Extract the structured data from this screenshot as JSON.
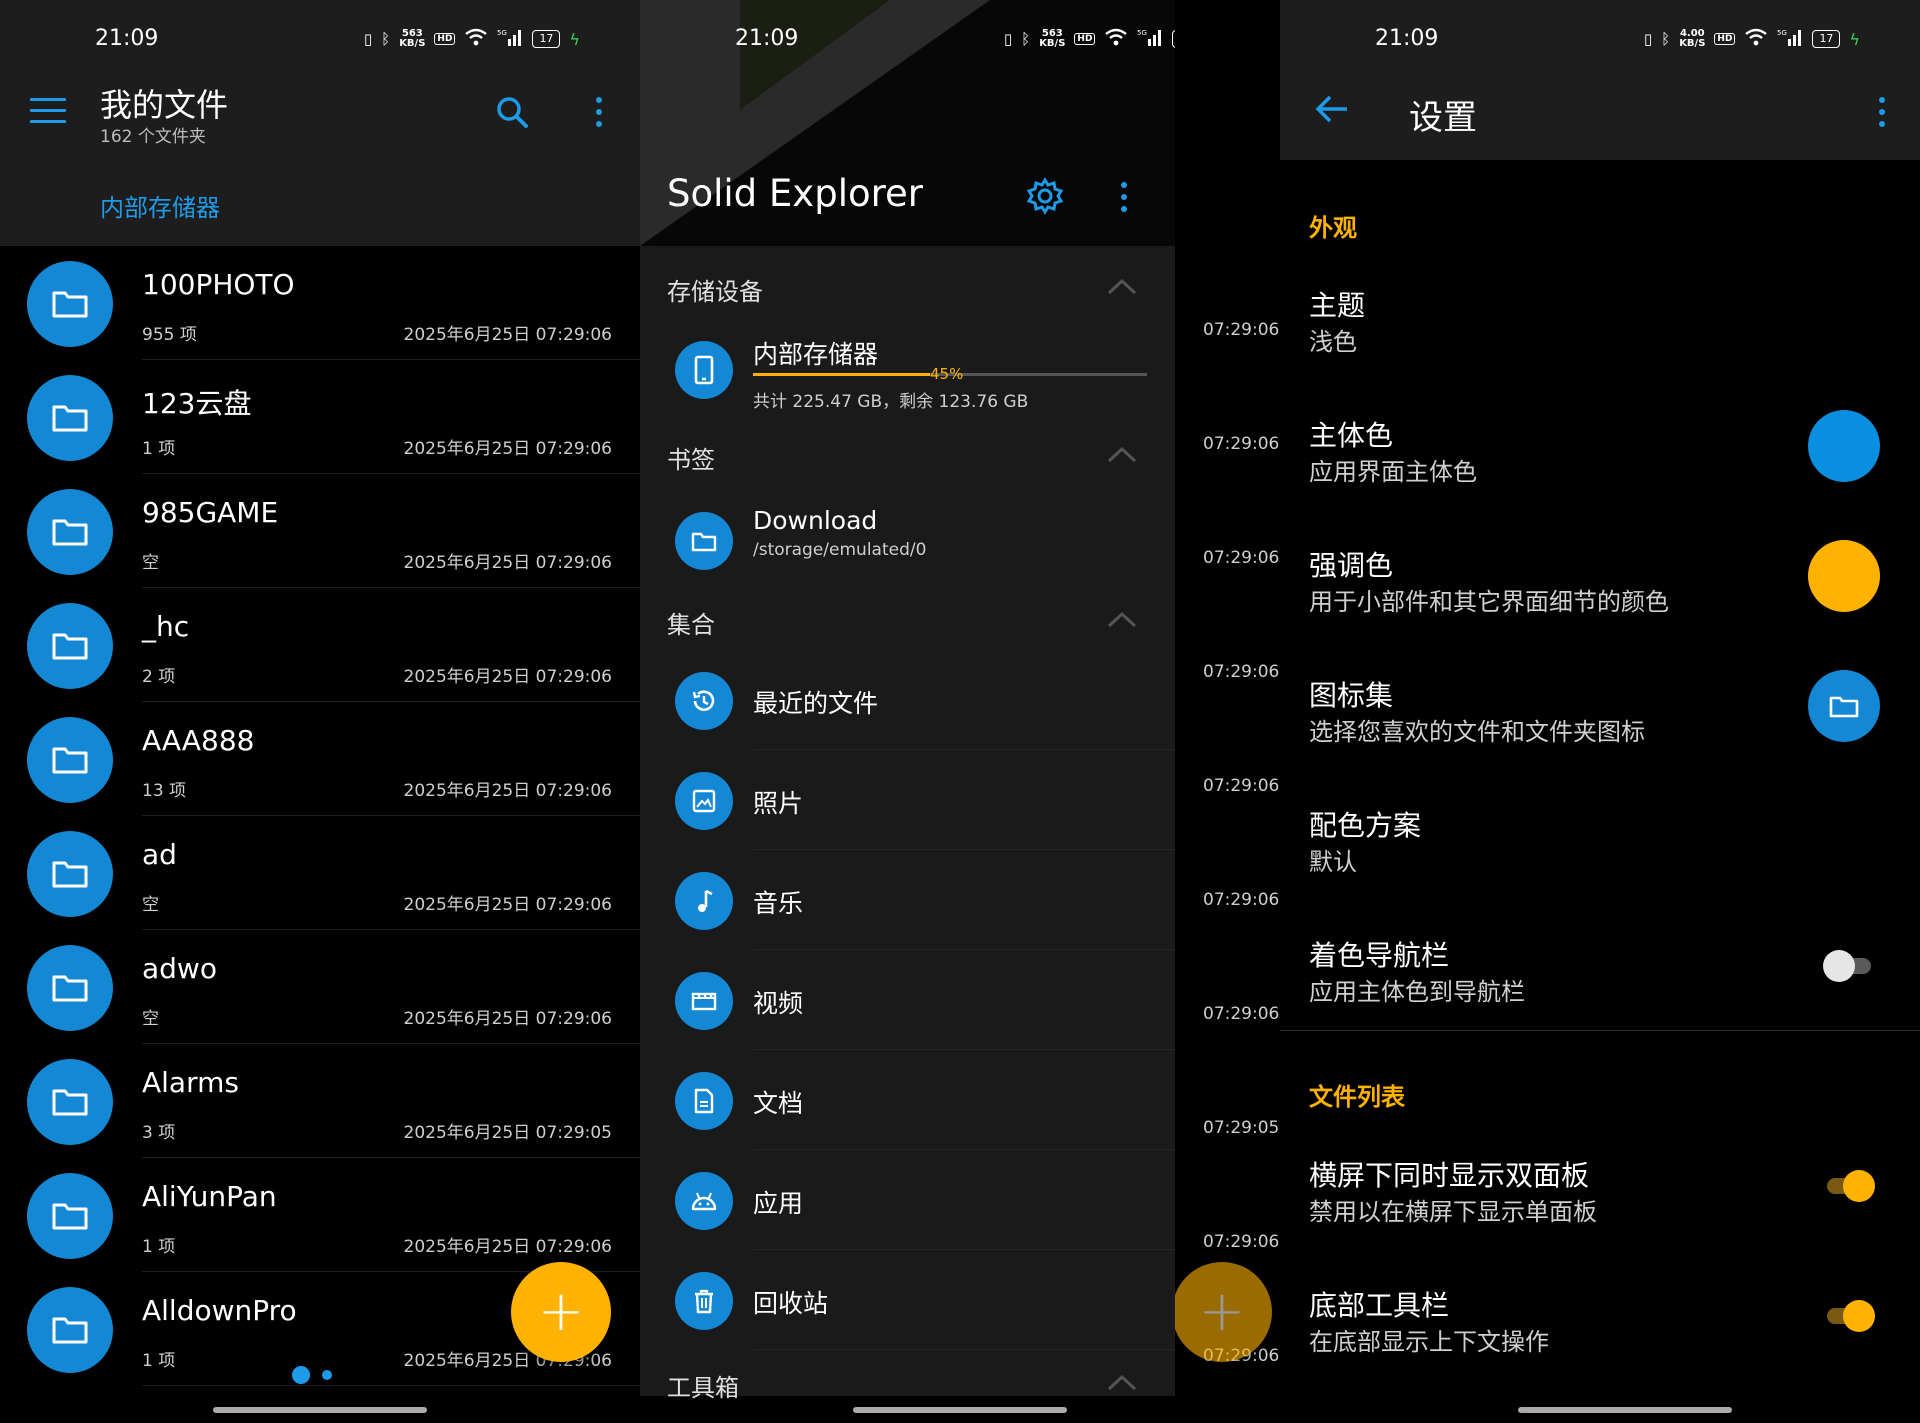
{
  "status": {
    "s1": {
      "time": "21:09",
      "speed": "563\nKB/S",
      "battery": "17"
    },
    "s2": {
      "time": "21:09",
      "speed": "563\nKB/S",
      "battery": "17"
    },
    "s3": {
      "time": "21:09",
      "speed": "4.00\nKB/S",
      "battery": "17"
    },
    "hd": "HD",
    "net": "5G"
  },
  "files_screen": {
    "title": "我的文件",
    "subtitle": "162 个文件夹",
    "breadcrumb": "内部存储器",
    "items": [
      {
        "name": "100PHOTO",
        "count": "955 项",
        "date": "2025年6月25日 07:29:06"
      },
      {
        "name": "123云盘",
        "count": "1 项",
        "date": "2025年6月25日 07:29:06"
      },
      {
        "name": "985GAME",
        "count": "空",
        "date": "2025年6月25日 07:29:06"
      },
      {
        "name": "_hc",
        "count": "2 项",
        "date": "2025年6月25日 07:29:06"
      },
      {
        "name": "AAA888",
        "count": "13 项",
        "date": "2025年6月25日 07:29:06"
      },
      {
        "name": "ad",
        "count": "空",
        "date": "2025年6月25日 07:29:06"
      },
      {
        "name": "adwo",
        "count": "空",
        "date": "2025年6月25日 07:29:06"
      },
      {
        "name": "Alarms",
        "count": "3 项",
        "date": "2025年6月25日 07:29:05"
      },
      {
        "name": "AliYunPan",
        "count": "1 项",
        "date": "2025年6月25日 07:29:06"
      },
      {
        "name": "AlldownPro",
        "count": "1 项",
        "date": "2025年6月25日 07:29:06"
      }
    ],
    "fab_label": "+"
  },
  "drawer_screen": {
    "app_title": "Solid Explorer",
    "section_storage": "存储设备",
    "storage": {
      "name": "内部存储器",
      "percent": "45%",
      "percent_value": 45,
      "info": "共计 225.47 GB，剩余 123.76 GB"
    },
    "section_bookmarks": "书签",
    "bookmark": {
      "name": "Download",
      "path": "/storage/emulated/0"
    },
    "section_collections": "集合",
    "collections": [
      {
        "label": "最近的文件",
        "icon": "history-icon"
      },
      {
        "label": "照片",
        "icon": "image-icon"
      },
      {
        "label": "音乐",
        "icon": "music-note-icon"
      },
      {
        "label": "视频",
        "icon": "video-icon"
      },
      {
        "label": "文档",
        "icon": "document-icon"
      },
      {
        "label": "应用",
        "icon": "android-icon"
      },
      {
        "label": "回收站",
        "icon": "trash-icon"
      }
    ],
    "section_tools": "工具箱",
    "background_times": [
      "07:29:06",
      "07:29:06",
      "07:29:06",
      "07:29:06",
      "07:29:06",
      "07:29:06",
      "07:29:06",
      "07:29:05",
      "07:29:06",
      "07:29:06"
    ]
  },
  "settings_screen": {
    "title": "设置",
    "cat_appearance": "外观",
    "theme": {
      "title": "主题",
      "sub": "浅色"
    },
    "primary": {
      "title": "主体色",
      "sub": "应用界面主体色",
      "color": "#0a8fe0"
    },
    "accent": {
      "title": "强调色",
      "sub": "用于小部件和其它界面细节的颜色",
      "color": "#ffb300"
    },
    "iconset": {
      "title": "图标集",
      "sub": "选择您喜欢的文件和文件夹图标"
    },
    "scheme": {
      "title": "配色方案",
      "sub": "默认"
    },
    "navbar": {
      "title": "着色导航栏",
      "sub": "应用主体色到导航栏",
      "on": false
    },
    "cat_filelist": "文件列表",
    "dualpane": {
      "title": "横屏下同时显示双面板",
      "sub": "禁用以在横屏下显示单面板",
      "on": true
    },
    "bottombar": {
      "title": "底部工具栏",
      "sub": "在底部显示上下文操作",
      "on": true
    }
  },
  "colors": {
    "primary": "#1e9be8",
    "accent": "#ffb300"
  }
}
